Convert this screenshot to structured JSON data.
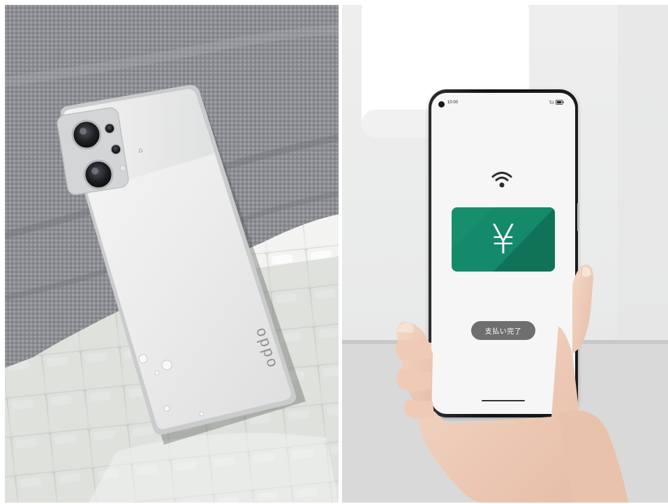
{
  "left_photo": {
    "brand_text": "oppo"
  },
  "right_photo": {
    "screen": {
      "status_time": "10:00",
      "signal_text": "Tıl",
      "nfc_icon": "contactless-payment-icon",
      "card_symbol": "¥",
      "card_color": "#118366",
      "payment_status": "支払い完了"
    }
  }
}
